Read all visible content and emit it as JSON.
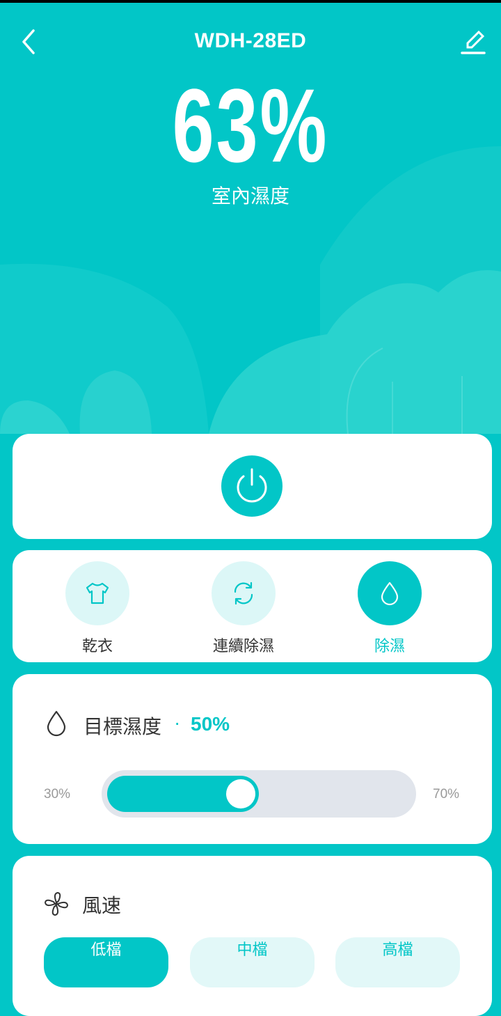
{
  "header": {
    "title": "WDH-28ED"
  },
  "humidity": {
    "value": "63%",
    "label": "室內濕度"
  },
  "modes": [
    {
      "label": "乾衣",
      "icon": "shirt-icon",
      "active": false
    },
    {
      "label": "連續除濕",
      "icon": "cycle-icon",
      "active": false
    },
    {
      "label": "除濕",
      "icon": "droplet-icon",
      "active": true
    }
  ],
  "target": {
    "title": "目標濕度",
    "separator": "·",
    "value": "50%",
    "min_label": "30%",
    "max_label": "70%",
    "level": 0.5
  },
  "fan": {
    "title": "風速",
    "options": [
      "低檔",
      "中檔",
      "高檔"
    ],
    "selected": "低檔"
  },
  "colors": {
    "accent": "#02c6c7",
    "card": "#ffffff",
    "accent_light": "#dcf7f7",
    "track": "#e1e5ec"
  }
}
